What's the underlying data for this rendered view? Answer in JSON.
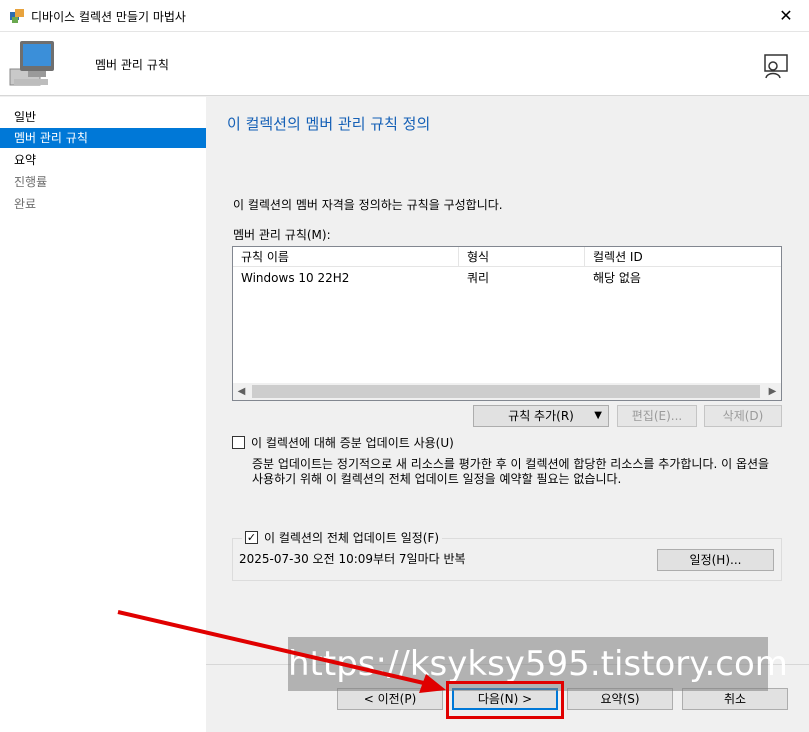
{
  "window": {
    "title": "디바이스 컬렉션 만들기 마법사",
    "close_glyph": "✕"
  },
  "header": {
    "title": "멤버 관리 규칙"
  },
  "sidebar": {
    "items": [
      {
        "label": "일반",
        "state": "normal"
      },
      {
        "label": "멤버 관리 규칙",
        "state": "active"
      },
      {
        "label": "요약",
        "state": "normal"
      },
      {
        "label": "진행률",
        "state": "disabled"
      },
      {
        "label": "완료",
        "state": "disabled"
      }
    ]
  },
  "main": {
    "page_title": "이 컬렉션의 멤버 관리 규칙 정의",
    "description": "이 컬렉션의 멤버 자격을 정의하는 규칙을 구성합니다.",
    "rules_label": "멤버 관리 규칙(M):",
    "rules_table": {
      "columns": [
        "규칙 이름",
        "형식",
        "컬렉션 ID"
      ],
      "rows": [
        [
          "Windows 10 22H2",
          "쿼리",
          "해당 없음"
        ]
      ]
    },
    "buttons": {
      "add_rule": "규칙 추가(R)",
      "edit": "편집(E)...",
      "delete": "삭제(D)"
    },
    "incremental": {
      "label": "이 컬렉션에 대해 증분 업데이트 사용(U)",
      "checked": false,
      "note": "증분 업데이트는 정기적으로 새 리소스를 평가한 후 이 컬렉션에 합당한 리소스를 추가합니다. 이 옵션을 사용하기 위해 이 컬렉션의 전체 업데이트 일정을 예약할 필요는 없습니다."
    },
    "full_update": {
      "label": "이 컬렉션의 전체 업데이트 일정(F)",
      "checked": true,
      "schedule": "2025-07-30 오전 10:09부터 7일마다 반복",
      "schedule_button": "일정(H)..."
    }
  },
  "footer": {
    "prev": "< 이전(P)",
    "next": "다음(N) >",
    "summary": "요약(S)",
    "cancel": "취소"
  },
  "overlay": {
    "watermark": "https://ksyksy595.tistory.com",
    "annotation_color": "#e00000"
  }
}
